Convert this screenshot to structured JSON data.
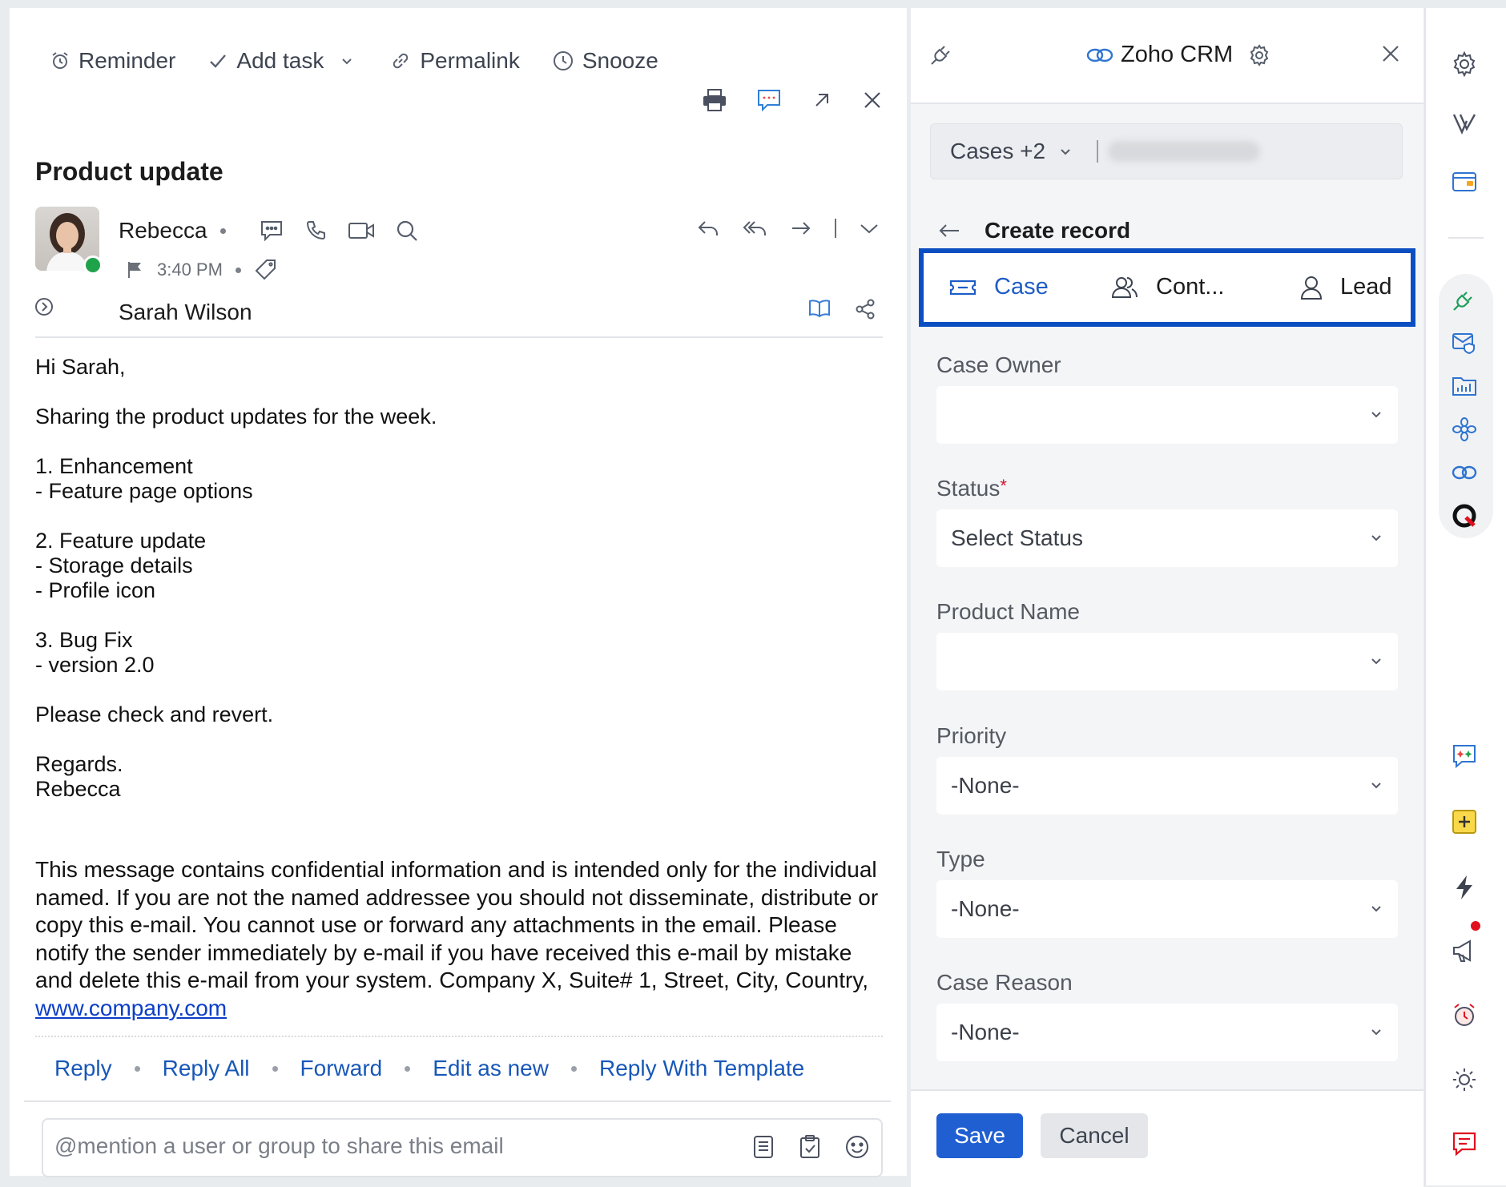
{
  "mail": {
    "toolbar": {
      "reminder": "Reminder",
      "add_task": "Add task",
      "permalink": "Permalink",
      "snooze": "Snooze"
    },
    "subject": "Product update",
    "sender": {
      "name": "Rebecca",
      "time": "3:40 PM"
    },
    "recipient": "Sarah Wilson",
    "body": {
      "greeting": "Hi Sarah,",
      "intro": "Sharing the product updates for the week.",
      "s1_title": "1. Enhancement",
      "s1_item1": "- Feature page options",
      "s2_title": "2. Feature update",
      "s2_item1": "- Storage details",
      "s2_item2": "- Profile icon",
      "s3_title": "3. Bug Fix",
      "s3_item1": "- version 2.0",
      "closing": "Please check and revert.",
      "signoff": "Regards.",
      "signature": "Rebecca"
    },
    "disclaimer": "This message contains confidential information and is intended only for the individual named. If you are not the named addressee you should not disseminate, distribute or copy this e-mail. You cannot use or forward any attachments in the email. Please notify the sender immediately by e-mail if you have received this e-mail by mistake and delete this e-mail from your system. Company X, Suite# 1, Street, City, Country,",
    "disclaimer_link": "www.company.com",
    "reply_actions": {
      "reply": "Reply",
      "reply_all": "Reply All",
      "forward": "Forward",
      "edit_as_new": "Edit as new",
      "reply_with_template": "Reply With Template"
    },
    "mention_placeholder": "@mention a user or group to share this email"
  },
  "crm": {
    "title": "Zoho CRM",
    "module_selector": "Cases +2",
    "back_label": "Create record",
    "tabs": {
      "case": "Case",
      "contact": "Cont...",
      "lead": "Lead"
    },
    "fields": {
      "case_owner": {
        "label": "Case Owner",
        "value": ""
      },
      "status": {
        "label": "Status",
        "required": "*",
        "value": "Select Status"
      },
      "product_name": {
        "label": "Product Name",
        "value": ""
      },
      "priority": {
        "label": "Priority",
        "value": "-None-"
      },
      "type": {
        "label": "Type",
        "value": "-None-"
      },
      "case_reason": {
        "label": "Case Reason",
        "value": "-None-"
      }
    },
    "save": "Save",
    "cancel": "Cancel"
  },
  "colors": {
    "accent": "#1f5fd1",
    "highlight_border": "#0b4ec2",
    "link": "#1857b8",
    "presence": "#1fa34a",
    "notification": "#e0101e"
  }
}
